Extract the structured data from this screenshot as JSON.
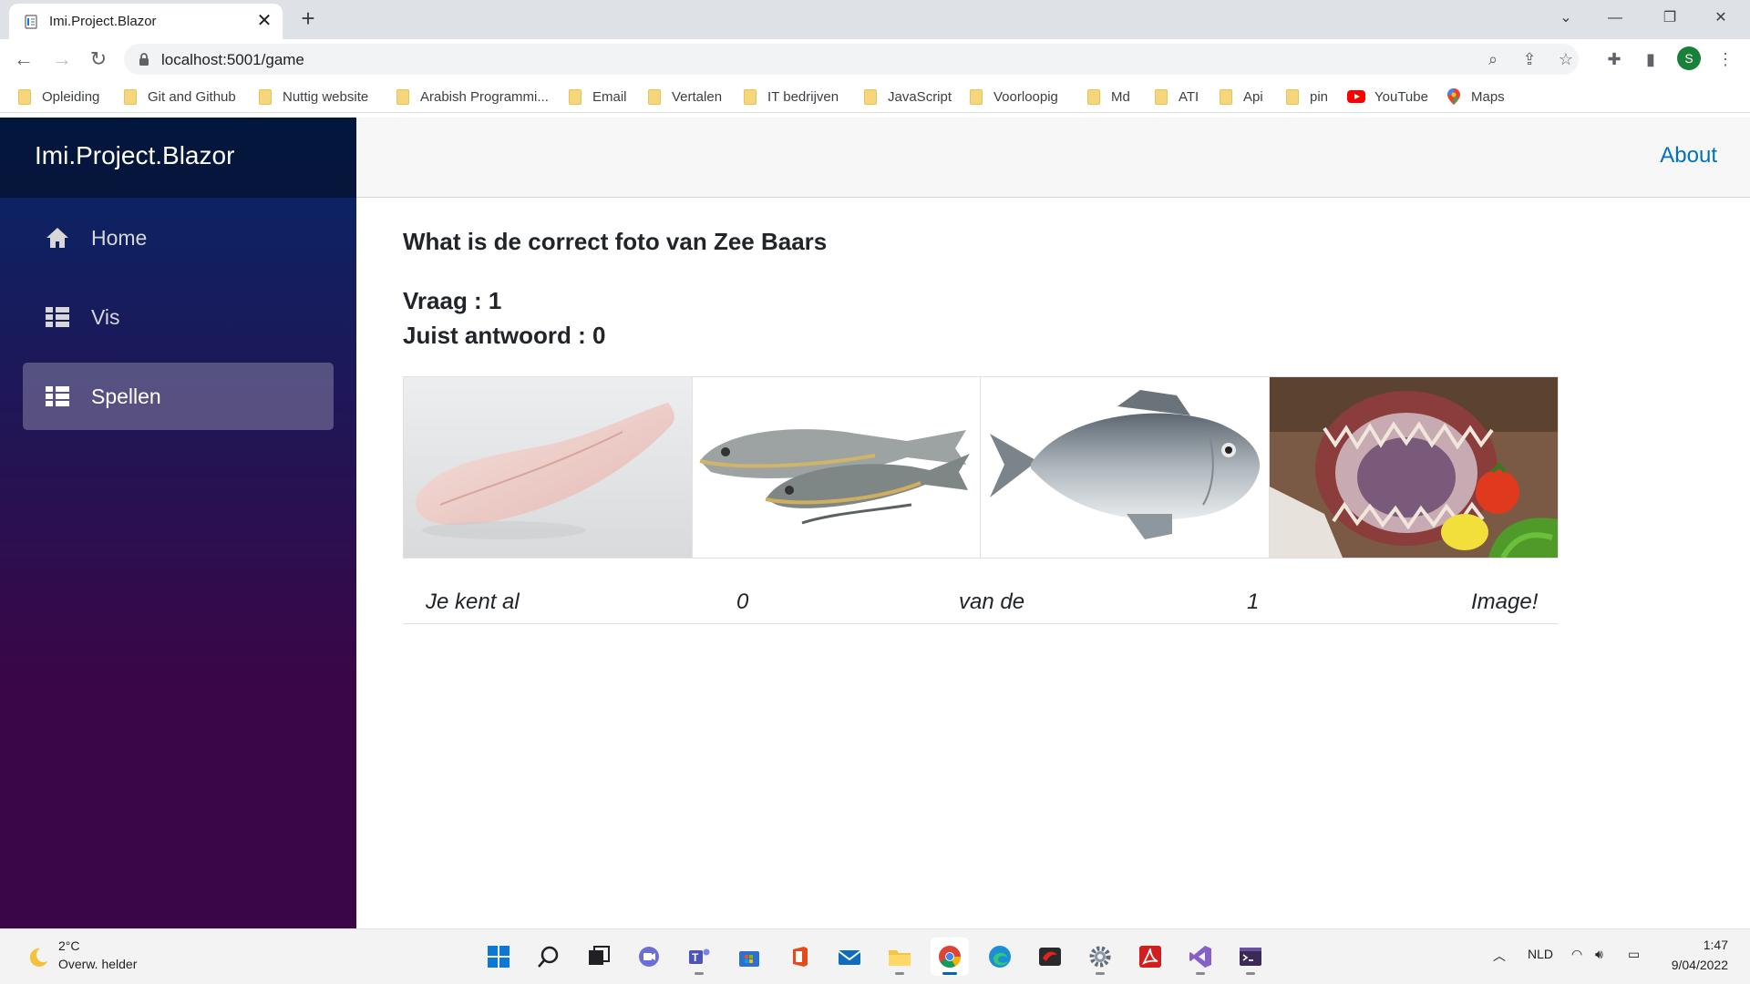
{
  "browser": {
    "tab_title": "Imi.Project.Blazor",
    "url": "localhost:5001/game",
    "new_tab_symbol": "+",
    "close_tab_symbol": "✕",
    "profile_initial": "S"
  },
  "bookmarks": [
    {
      "label": "Opleiding",
      "icon": "folder-icon"
    },
    {
      "label": "Git and Github",
      "icon": "folder-icon"
    },
    {
      "label": "Nuttig website",
      "icon": "folder-icon"
    },
    {
      "label": "Arabish Programmi...",
      "icon": "folder-icon"
    },
    {
      "label": "Email",
      "icon": "folder-icon"
    },
    {
      "label": "Vertalen",
      "icon": "folder-icon"
    },
    {
      "label": "IT bedrijven",
      "icon": "folder-icon"
    },
    {
      "label": "JavaScript",
      "icon": "folder-icon"
    },
    {
      "label": "Voorloopig",
      "icon": "folder-icon"
    },
    {
      "label": "Md",
      "icon": "folder-icon"
    },
    {
      "label": "ATI",
      "icon": "folder-icon"
    },
    {
      "label": "Api",
      "icon": "folder-icon"
    },
    {
      "label": "pin",
      "icon": "folder-icon"
    },
    {
      "label": "YouTube",
      "icon": "youtube-icon"
    },
    {
      "label": "Maps",
      "icon": "maps-icon"
    }
  ],
  "app": {
    "brand": "Imi.Project.Blazor",
    "nav": [
      {
        "label": "Home",
        "icon": "home-icon",
        "active": false
      },
      {
        "label": "Vis",
        "icon": "list-icon",
        "active": false
      },
      {
        "label": "Spellen",
        "icon": "list-icon",
        "active": true
      }
    ],
    "about_link": "About"
  },
  "game": {
    "question": "What is de correct foto van Zee Baars",
    "vraag": "Vraag : 1",
    "juist": "Juist antwoord : 0",
    "images": [
      {
        "name": "fish-fillet-image"
      },
      {
        "name": "sea-bream-image"
      },
      {
        "name": "sea-bass-image"
      },
      {
        "name": "monkfish-image"
      }
    ],
    "score": {
      "prefix": "Je kent al",
      "known": "0",
      "middle": "van de",
      "total": "1",
      "suffix": "Image!"
    }
  },
  "taskbar": {
    "weather_temp": "2°C",
    "weather_desc": "Overw. helder",
    "language": "NLD",
    "time": "1:47",
    "date": "9/04/2022"
  },
  "colors": {
    "sidebar_top": "#052767",
    "sidebar_bottom": "#3a0647",
    "link": "#0071c1"
  }
}
